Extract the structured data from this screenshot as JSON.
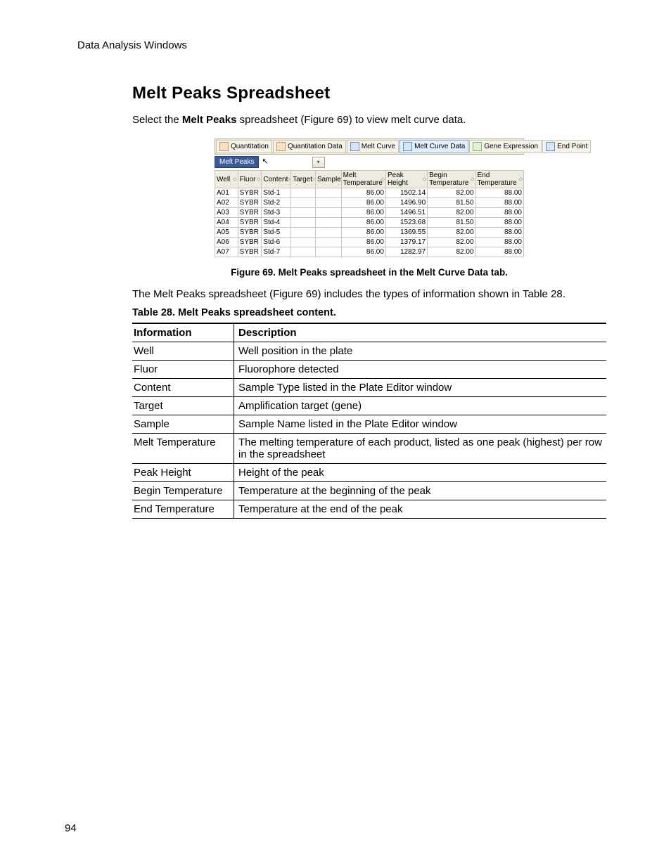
{
  "running_head": "Data Analysis Windows",
  "page_number": "94",
  "heading": "Melt Peaks Spreadsheet",
  "intro": {
    "prefix": "Select the ",
    "bold": "Melt Peaks",
    "suffix": " spreadsheet (Figure 69) to view melt curve data."
  },
  "figure": {
    "tabs": [
      {
        "label": "Quantitation"
      },
      {
        "label": "Quantitation Data"
      },
      {
        "label": "Melt Curve"
      },
      {
        "label": "Melt Curve Data",
        "selected": true
      },
      {
        "label": "Gene Expression"
      },
      {
        "label": "End Point"
      }
    ],
    "sub_tab": "Melt Peaks",
    "cursor_glyph": "↖",
    "dropdown_glyph": "▾",
    "columns": [
      "Well",
      "Fluor",
      "Content",
      "Target",
      "Sample",
      "Melt Temperature",
      "Peak Height",
      "Begin Temperature",
      "End Temperature"
    ],
    "col_widths": [
      "32",
      "33",
      "41",
      "34",
      "36",
      "62",
      "58",
      "67",
      "67"
    ],
    "sort_glyph": "◇",
    "rows": [
      {
        "well": "A01",
        "fluor": "SYBR",
        "content": "Std-1",
        "target": "",
        "sample": "",
        "melt": "86.00",
        "peak": "1502.14",
        "begin": "82.00",
        "end": "88.00"
      },
      {
        "well": "A02",
        "fluor": "SYBR",
        "content": "Std-2",
        "target": "",
        "sample": "",
        "melt": "86.00",
        "peak": "1496.90",
        "begin": "81.50",
        "end": "88.00"
      },
      {
        "well": "A03",
        "fluor": "SYBR",
        "content": "Std-3",
        "target": "",
        "sample": "",
        "melt": "86.00",
        "peak": "1496.51",
        "begin": "82.00",
        "end": "88.00"
      },
      {
        "well": "A04",
        "fluor": "SYBR",
        "content": "Std-4",
        "target": "",
        "sample": "",
        "melt": "86.00",
        "peak": "1523.68",
        "begin": "81.50",
        "end": "88.00"
      },
      {
        "well": "A05",
        "fluor": "SYBR",
        "content": "Std-5",
        "target": "",
        "sample": "",
        "melt": "86.00",
        "peak": "1369.55",
        "begin": "82.00",
        "end": "88.00"
      },
      {
        "well": "A06",
        "fluor": "SYBR",
        "content": "Std-6",
        "target": "",
        "sample": "",
        "melt": "86.00",
        "peak": "1379.17",
        "begin": "82.00",
        "end": "88.00"
      },
      {
        "well": "A07",
        "fluor": "SYBR",
        "content": "Std-7",
        "target": "",
        "sample": "",
        "melt": "86.00",
        "peak": "1282.97",
        "begin": "82.00",
        "end": "88.00"
      }
    ],
    "caption": "Figure 69. Melt Peaks spreadsheet in the Melt Curve Data tab."
  },
  "after_fig": "The Melt Peaks spreadsheet (Figure 69) includes the types of information shown in Table 28.",
  "table28": {
    "caption": "Table 28.  Melt Peaks spreadsheet content.",
    "head": {
      "info": "Information",
      "desc": "Description"
    },
    "rows": [
      {
        "info": "Well",
        "desc": "Well position in the plate"
      },
      {
        "info": "Fluor",
        "desc": "Fluorophore detected"
      },
      {
        "info": "Content",
        "desc": "Sample Type listed in the Plate Editor window"
      },
      {
        "info": "Target",
        "desc": "Amplification target (gene)"
      },
      {
        "info": "Sample",
        "desc": "Sample Name listed in the Plate Editor window"
      },
      {
        "info": "Melt Temperature",
        "desc": "The melting temperature of each product, listed as one peak (highest) per row in the spreadsheet"
      },
      {
        "info": "Peak Height",
        "desc": "Height of the peak"
      },
      {
        "info": "Begin Temperature",
        "desc": "Temperature at the beginning of the peak"
      },
      {
        "info": "End Temperature",
        "desc": "Temperature at the end of the peak"
      }
    ]
  }
}
